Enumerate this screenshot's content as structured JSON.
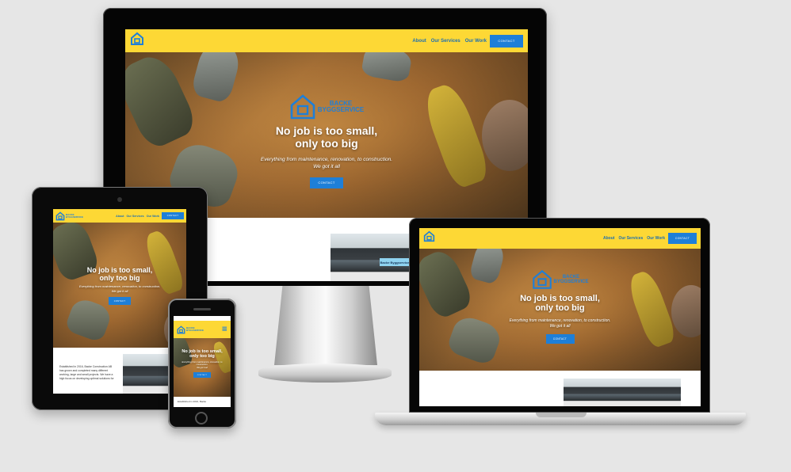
{
  "brand": {
    "line1": "BACKE",
    "line2": "BYGGSERVICE"
  },
  "nav": {
    "about": "About",
    "services": "Our Services",
    "work": "Our Work",
    "contact": "CONTACT"
  },
  "hero": {
    "title_line1": "No job is too small,",
    "title_line2": "only too big",
    "subtitle_line1": "Everything from maintenance, renovation, to construction.",
    "subtitle_line2": "We got it all",
    "button": "CONTACT"
  },
  "about": {
    "text": "Established in 2016, Backe Construction AB has grown and completed many different working, large and small projects. We have a high focus on developing optimal solutions for",
    "phone_text": "Established in 2016, Backe"
  },
  "photo": {
    "sign": "Backe Byggservice"
  },
  "colors": {
    "nav_bg": "#fdd835",
    "accent_blue": "#1e7fd8",
    "link_blue": "#1e6fb0",
    "backdrop": "#e6e6e6"
  },
  "icons": {
    "logo": "house-icon",
    "menu": "hamburger-icon"
  }
}
